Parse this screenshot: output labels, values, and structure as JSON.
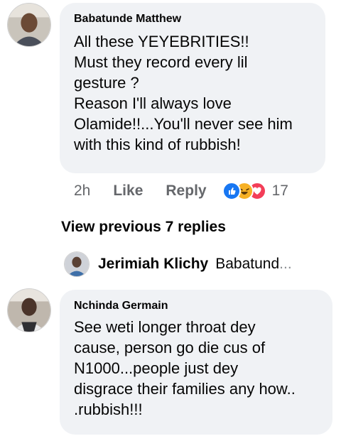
{
  "comments": [
    {
      "author": "Babatunde Matthew",
      "text": "All these YEYEBRITIES!!\nMust they record every lil\ngesture ?\nReason I'll always love\nOlamide!!...You'll never see him\nwith this kind of rubbish!",
      "time": "2h",
      "like_label": "Like",
      "reply_label": "Reply",
      "reactions": [
        "like-icon",
        "haha-icon",
        "love-icon"
      ],
      "reaction_count": "17"
    },
    {
      "author": "Nchinda Germain",
      "text": "See weti longer throat dey\ncause, person go die cus of\nN1000...people just dey\ndisgrace their families any how..\n.rubbish!!!"
    }
  ],
  "view_previous": "View previous 7 replies",
  "reply_preview": {
    "name": "Jerimiah Klichy",
    "text": "Babatund",
    "ellipsis": "..."
  },
  "colors": {
    "bubble": "#f0f2f5",
    "secondary_text": "#65676b",
    "like_blue": "#1877f2",
    "haha_yellow": "#f7b125",
    "love_red": "#f33e58"
  }
}
